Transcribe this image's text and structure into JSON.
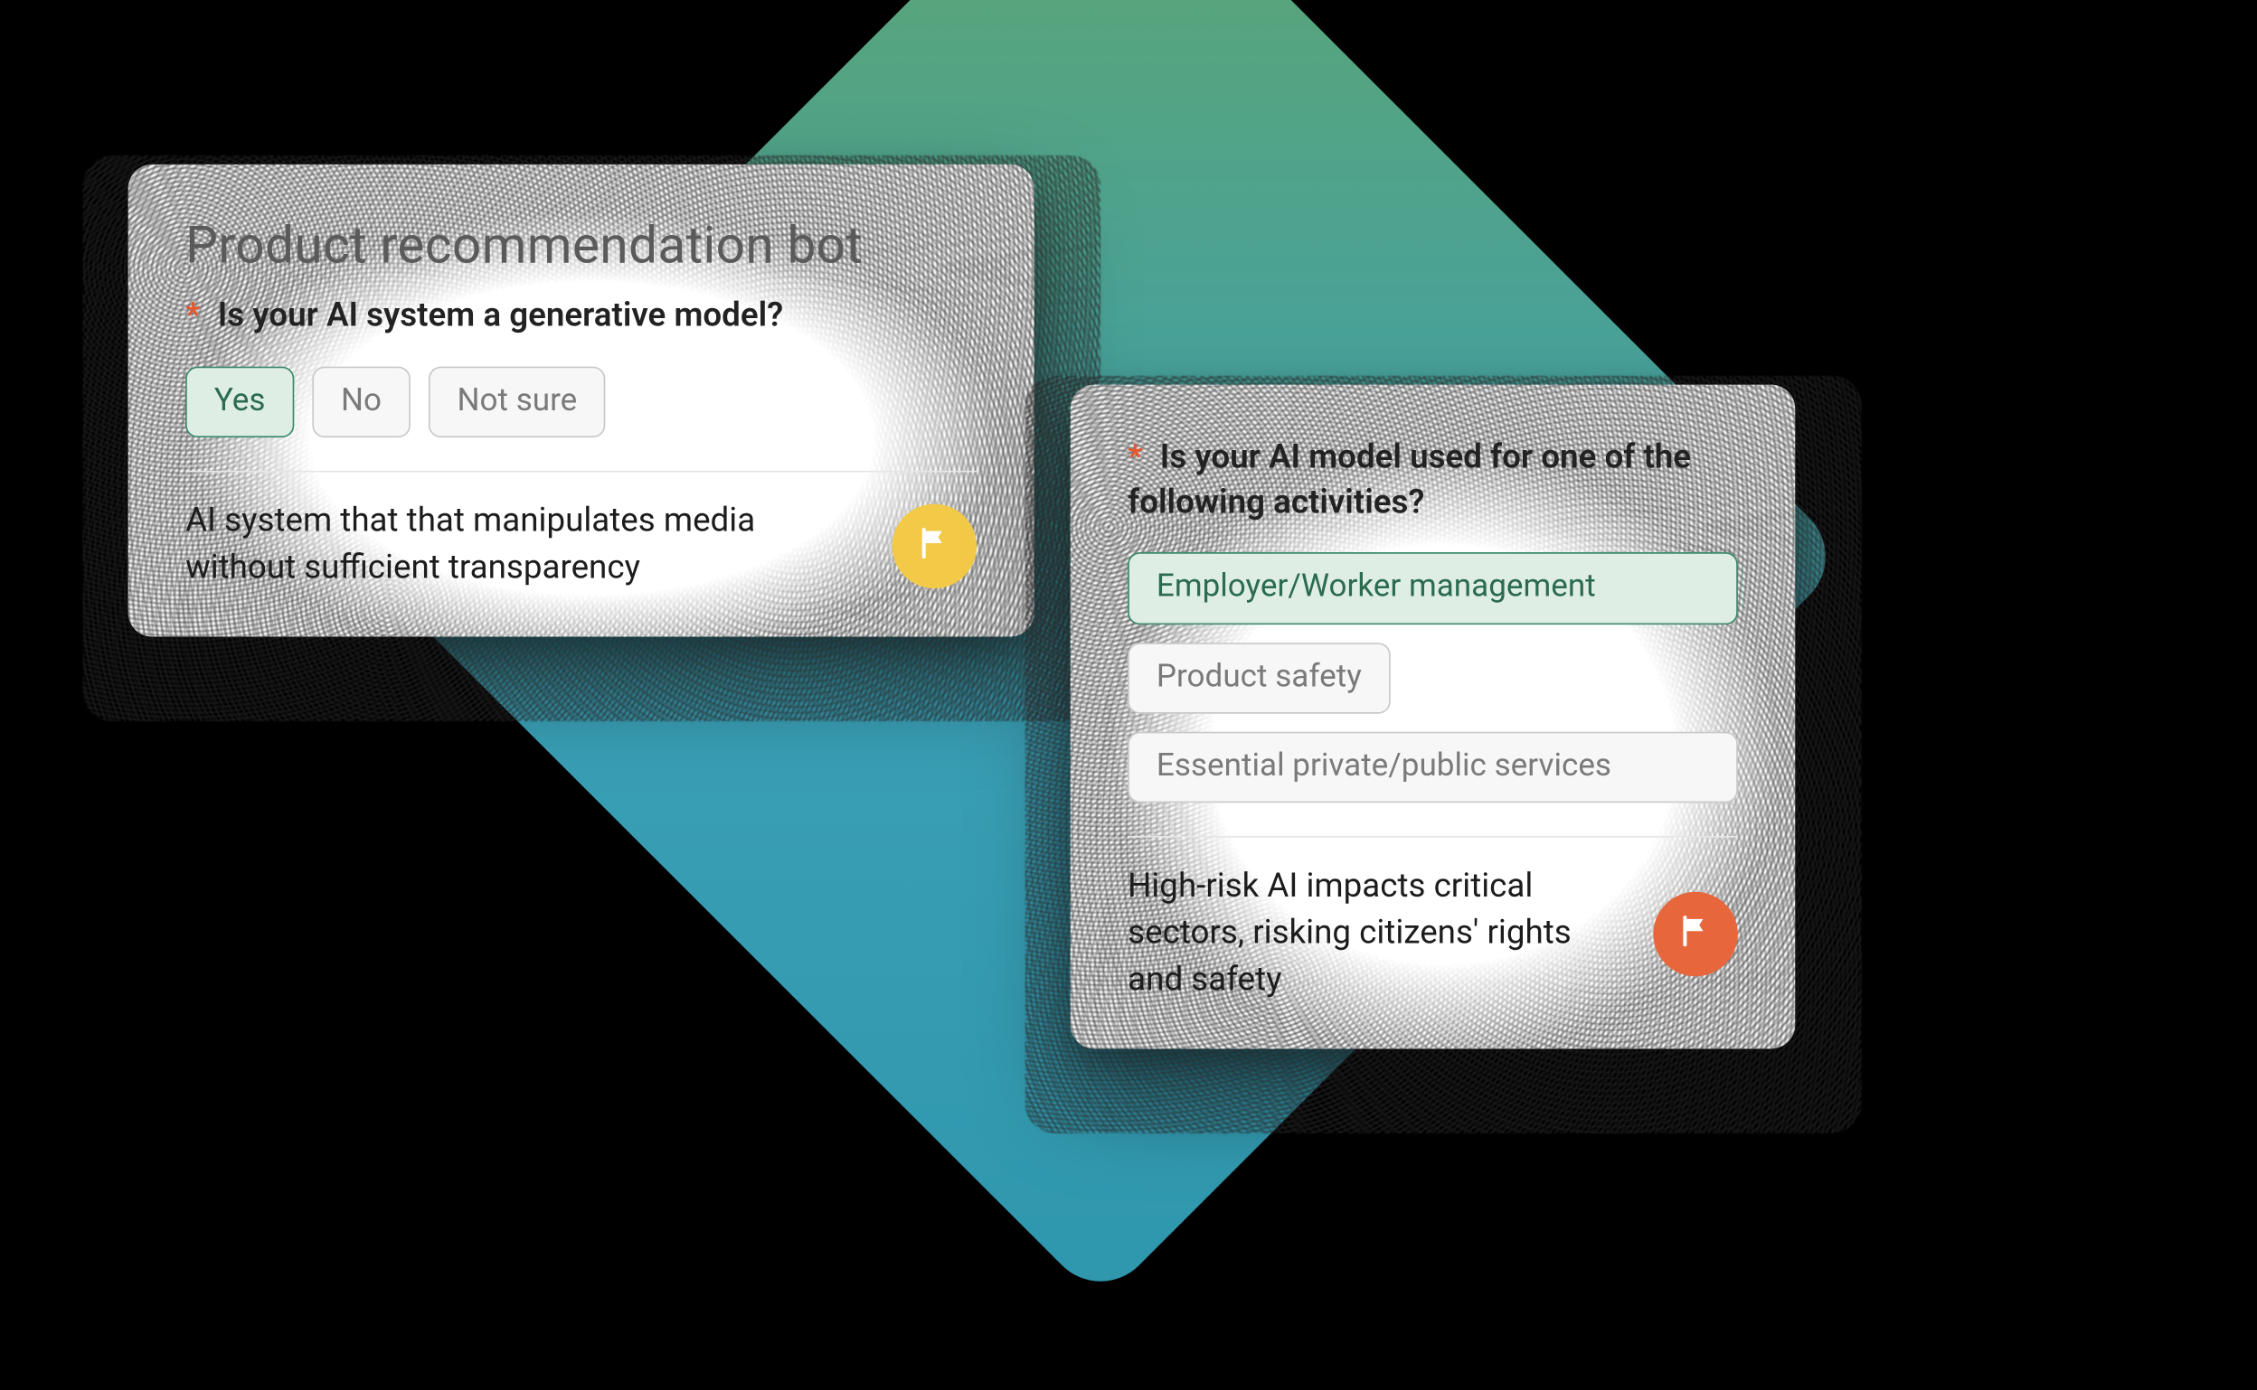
{
  "card1": {
    "title": "Product recommendation bot",
    "question": "Is your AI system a generative model?",
    "options": {
      "yes": "Yes",
      "no": "No",
      "notsure": "Not sure"
    },
    "result_text": "AI system that that manipulates media without sufficient transparency"
  },
  "card2": {
    "question": "Is your AI model used for one of the following activities?",
    "options": {
      "emp": "Employer/Worker management",
      "prod": "Product safety",
      "ess": "Essential private/public services"
    },
    "result_text": "High-risk AI impacts critical sectors, risking citizens' rights and safety"
  }
}
